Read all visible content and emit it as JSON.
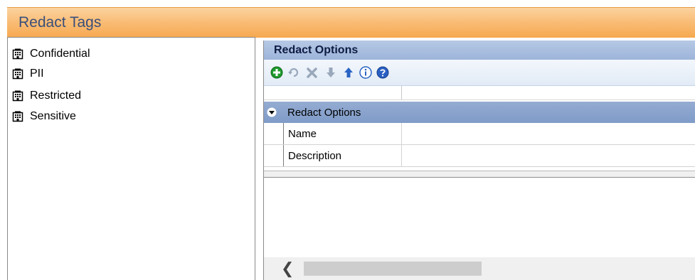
{
  "window": {
    "title": "Redact Tags"
  },
  "tags": [
    {
      "label": "Confidential",
      "icon": "building-icon"
    },
    {
      "label": "PII",
      "icon": "building-icon"
    },
    {
      "label": "Restricted",
      "icon": "building-icon"
    },
    {
      "label": "Sensitive",
      "icon": "building-icon"
    }
  ],
  "options_panel": {
    "header": "Redact Options",
    "toolbar": [
      {
        "name": "add-icon",
        "enabled": true
      },
      {
        "name": "refresh-icon",
        "enabled": false
      },
      {
        "name": "delete-icon",
        "enabled": false
      },
      {
        "name": "move-down-icon",
        "enabled": false
      },
      {
        "name": "move-up-icon",
        "enabled": true
      },
      {
        "name": "info-icon",
        "enabled": true
      },
      {
        "name": "help-icon",
        "enabled": true
      }
    ],
    "category": "Redact Options",
    "properties": [
      {
        "name": "Name",
        "value": ""
      },
      {
        "name": "Description",
        "value": ""
      }
    ]
  },
  "colors": {
    "title_gradient_top": "#fbd3a0",
    "title_gradient_bottom": "#f6a850",
    "title_text": "#3a4f7a",
    "panel_header": "#9db4da",
    "category_row": "#7f9bc8"
  }
}
